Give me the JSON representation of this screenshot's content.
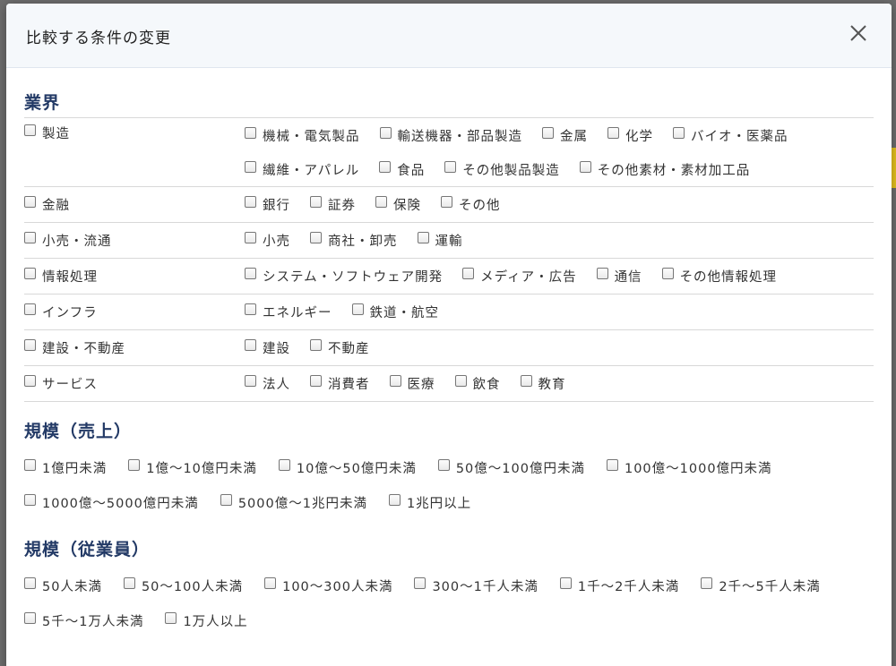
{
  "modal": {
    "title": "比較する条件の変更"
  },
  "industry": {
    "title": "業界",
    "rows": [
      {
        "label": "製造",
        "subs": [
          "機械・電気製品",
          "輸送機器・部品製造",
          "金属",
          "化学",
          "バイオ・医薬品",
          "繊維・アパレル",
          "食品",
          "その他製品製造",
          "その他素材・素材加工品"
        ]
      },
      {
        "label": "金融",
        "subs": [
          "銀行",
          "証券",
          "保険",
          "その他"
        ]
      },
      {
        "label": "小売・流通",
        "subs": [
          "小売",
          "商社・卸売",
          "運輸"
        ]
      },
      {
        "label": "情報処理",
        "subs": [
          "システム・ソフトウェア開発",
          "メディア・広告",
          "通信",
          "その他情報処理"
        ]
      },
      {
        "label": "インフラ",
        "subs": [
          "エネルギー",
          "鉄道・航空"
        ]
      },
      {
        "label": "建設・不動産",
        "subs": [
          "建設",
          "不動産"
        ]
      },
      {
        "label": "サービス",
        "subs": [
          "法人",
          "消費者",
          "医療",
          "飲食",
          "教育"
        ]
      }
    ]
  },
  "sales": {
    "title": "規模（売上）",
    "options": [
      "1億円未満",
      "1億〜10億円未満",
      "10億〜50億円未満",
      "50億〜100億円未満",
      "100億〜1000億円未満",
      "1000億〜5000億円未満",
      "5000億〜1兆円未満",
      "1兆円以上"
    ]
  },
  "employees": {
    "title": "規模（従業員）",
    "options": [
      "50人未満",
      "50〜100人未満",
      "100〜300人未満",
      "300〜1千人未満",
      "1千〜2千人未満",
      "2千〜5千人未満",
      "5千〜1万人未満",
      "1万人以上"
    ]
  },
  "icons": {
    "close": "close-icon",
    "checkbox": "checkbox"
  },
  "colors": {
    "section_title": "#233a66",
    "header_bg": "#f5f8fb"
  }
}
